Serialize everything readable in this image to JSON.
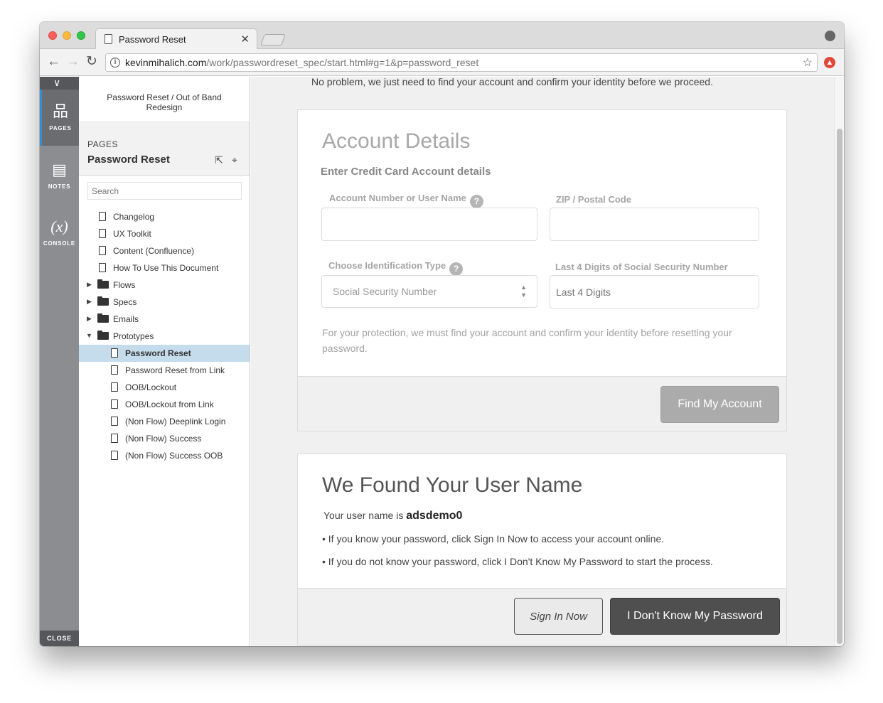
{
  "browser": {
    "tab_title": "Password Reset",
    "tab_close": "✕",
    "url_domain": "kevinmihalich.com",
    "url_path": "/work/passwordreset_spec/start.html#g=1&p=password_reset",
    "info_glyph": "i",
    "star_glyph": "☆",
    "ext_glyph": "▲",
    "nav_back": "←",
    "nav_forward": "→",
    "nav_reload": "↻"
  },
  "rail": {
    "collapse_glyph": "∨",
    "items": [
      {
        "label": "PAGES",
        "icon": "sitemap-icon",
        "glyph": "品"
      },
      {
        "label": "NOTES",
        "icon": "notes-icon",
        "glyph": "▤"
      },
      {
        "label": "CONSOLE",
        "icon": "console-icon",
        "glyph": "(x)"
      }
    ],
    "close_label": "CLOSE"
  },
  "sitemap": {
    "project_title": "Password Reset / Out of Band Redesign",
    "caption": "PAGES",
    "current_page": "Password Reset",
    "search_placeholder": "Search",
    "items": [
      {
        "label": "Changelog",
        "type": "page"
      },
      {
        "label": "UX Toolkit",
        "type": "page"
      },
      {
        "label": "Content (Confluence)",
        "type": "page"
      },
      {
        "label": "How To Use This Document",
        "type": "page"
      },
      {
        "label": "Flows",
        "type": "folder"
      },
      {
        "label": "Specs",
        "type": "folder"
      },
      {
        "label": "Emails",
        "type": "folder"
      },
      {
        "label": "Prototypes",
        "type": "folder-open"
      },
      {
        "label": "Password Reset",
        "type": "child",
        "selected": true
      },
      {
        "label": "Password Reset from Link",
        "type": "child"
      },
      {
        "label": "OOB/Lockout",
        "type": "child"
      },
      {
        "label": "OOB/Lockout from Link",
        "type": "child"
      },
      {
        "label": "(Non Flow) Deeplink Login",
        "type": "child"
      },
      {
        "label": "(Non Flow) Success",
        "type": "child"
      },
      {
        "label": "(Non Flow) Success OOB",
        "type": "child"
      }
    ]
  },
  "content": {
    "intro": "No problem, we just need to find your account and confirm your identity before we proceed.",
    "account_card": {
      "title": "Account Details",
      "subhead": "Enter Credit Card Account details",
      "account_label": "Account Number or User Name",
      "zip_label": "ZIP / Postal Code",
      "id_type_label": "Choose Identification Type",
      "id_type_value": "Social Security Number",
      "ssn_label": "Last 4 Digits of Social Security Number",
      "ssn_placeholder": "Last 4 Digits",
      "help_glyph": "?",
      "protection_text": "For your protection, we must find your account and confirm your identity before resetting your password.",
      "find_button": "Find My Account"
    },
    "found_card": {
      "title": "We Found Your User Name",
      "username_prefix": "Your user name is",
      "username": "adsdemo0",
      "bullet1": "• If you know your password, click Sign In Now to access your account online.",
      "bullet2": "• If you do not know your password, click I Don't Know My Password to start the process.",
      "sign_in_button": "Sign In Now",
      "dont_know_button": "I Don't Know My Password"
    }
  },
  "colors": {
    "accent_blue": "#2e8fd6",
    "selected_row": "#c5dcec",
    "rail_gray": "#8b8d90",
    "button_disabled": "#ababab",
    "button_dark": "#4f4f4f"
  }
}
